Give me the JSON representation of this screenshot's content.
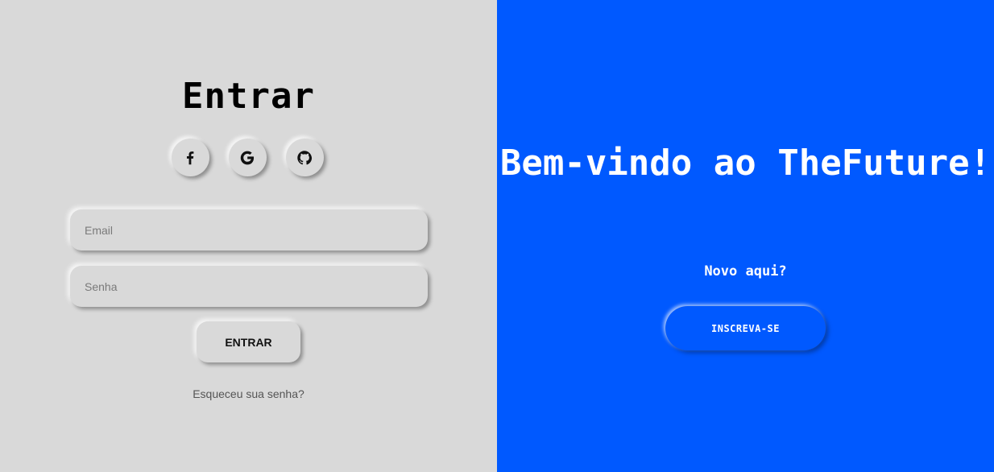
{
  "login": {
    "title": "Entrar",
    "social": [
      {
        "icon": "facebook-icon"
      },
      {
        "icon": "google-icon"
      },
      {
        "icon": "github-icon"
      }
    ],
    "email_placeholder": "Email",
    "password_placeholder": "Senha",
    "submit_label": "ENTRAR",
    "forgot_label": "Esqueceu sua senha?"
  },
  "signup_panel": {
    "welcome": "Bem-vindo ao TheFuture!",
    "subtitle": "Novo aqui?",
    "signup_label": "INSCREVA-SE"
  },
  "colors": {
    "left_background": "#d9d9d9",
    "right_background": "#0059ff",
    "text_dark": "#000000",
    "text_light": "#ffffff"
  }
}
